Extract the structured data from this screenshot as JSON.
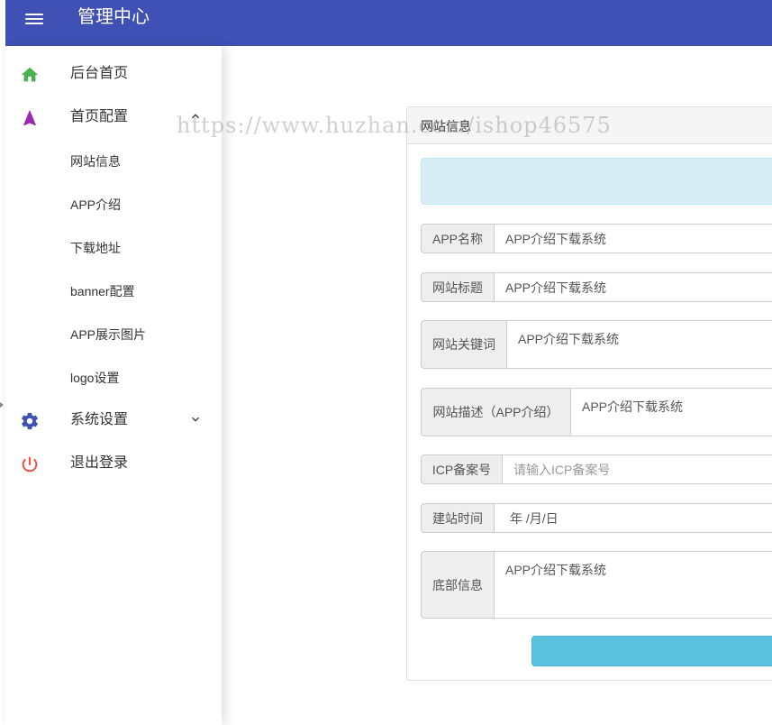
{
  "header": {
    "title": "管理中心",
    "menu_icon": "hamburger-icon"
  },
  "sidebar": {
    "items": [
      {
        "label": "后台首页",
        "icon": "home-icon",
        "color": "#4caf50"
      },
      {
        "label": "首页配置",
        "icon": "navigation-icon",
        "color": "#9c27b0",
        "expanded": true
      },
      {
        "label": "系统设置",
        "icon": "gear-icon",
        "color": "#3f51b5",
        "expanded": false
      },
      {
        "label": "退出登录",
        "icon": "power-icon",
        "color": "#f44336"
      }
    ],
    "subitems": [
      {
        "label": "网站信息"
      },
      {
        "label": "APP介绍"
      },
      {
        "label": "下载地址"
      },
      {
        "label": "banner配置"
      },
      {
        "label": "APP展示图片"
      },
      {
        "label": "logo设置"
      }
    ]
  },
  "watermark": "https://www.huzhan.com/ishop46575",
  "panel": {
    "title": "网站信息",
    "fields": [
      {
        "label": "APP名称",
        "value": "APP介绍下载系统"
      },
      {
        "label": "网站标题",
        "value": "APP介绍下载系统"
      },
      {
        "label": "网站关键词",
        "value": "APP介绍下载系统"
      },
      {
        "label": "网站描述（APP介绍）",
        "value": "APP介绍下载系统"
      },
      {
        "label": "ICP备案号",
        "value": "",
        "placeholder": "请输入ICP备案号"
      },
      {
        "label": "建站时间",
        "value": "年 /月/日"
      },
      {
        "label": "底部信息",
        "value": "APP介绍下载系统"
      }
    ]
  },
  "colors": {
    "primary": "#3f51b5",
    "info_alert": "#d9edf7",
    "submit": "#5bc0de"
  }
}
